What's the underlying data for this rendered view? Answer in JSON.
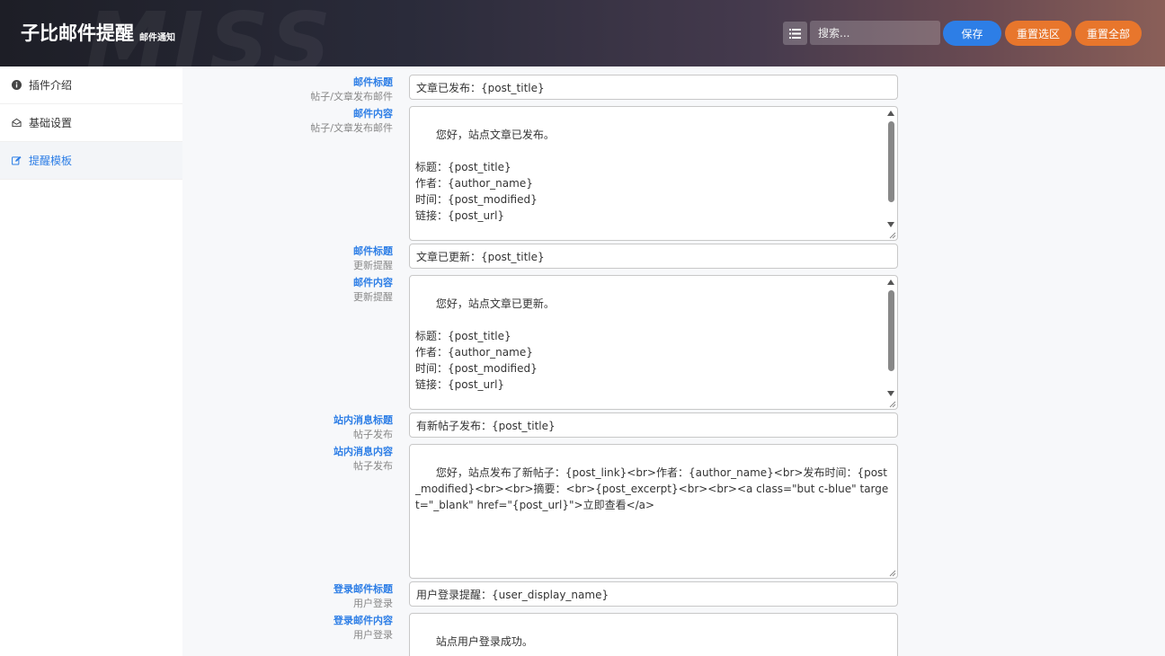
{
  "header": {
    "title": "子比邮件提醒",
    "subtitle": "邮件通知",
    "watermark": "MISS",
    "search_placeholder": "搜索...",
    "save_label": "保存",
    "reset_section_label": "重置选区",
    "reset_all_label": "重置全部"
  },
  "sidebar": {
    "items": [
      {
        "label": "插件介绍",
        "icon": "info-circle-icon"
      },
      {
        "label": "基础设置",
        "icon": "envelope-open-icon"
      },
      {
        "label": "提醒模板",
        "icon": "edit-icon",
        "active": true
      }
    ]
  },
  "fields": {
    "f1": {
      "label": "邮件标题",
      "desc": "帖子/文章发布邮件",
      "value": "文章已发布：{post_title}"
    },
    "f2": {
      "label": "邮件内容",
      "desc": "帖子/文章发布邮件",
      "value": "您好，站点文章已发布。\n\n标题：{post_title}\n作者：{author_name}\n时间：{post_modified}\n链接：{post_url}\n\n摘要："
    },
    "f3": {
      "label": "邮件标题",
      "desc": "更新提醒",
      "value": "文章已更新：{post_title}"
    },
    "f4": {
      "label": "邮件内容",
      "desc": "更新提醒",
      "value": "您好，站点文章已更新。\n\n标题：{post_title}\n作者：{author_name}\n时间：{post_modified}\n链接：{post_url}\n\n摘要："
    },
    "f5": {
      "label": "站内消息标题",
      "desc": "帖子发布",
      "value": "有新帖子发布：{post_title}"
    },
    "f6": {
      "label": "站内消息内容",
      "desc": "帖子发布",
      "value": "您好，站点发布了新帖子：{post_link}<br>作者：{author_name}<br>发布时间：{post_modified}<br><br>摘要：<br>{post_excerpt}<br><br><a class=\"but c-blue\" target=\"_blank\" href=\"{post_url}\">立即查看</a>"
    },
    "f7": {
      "label": "登录邮件标题",
      "desc": "用户登录",
      "value": "用户登录提醒：{user_display_name}"
    },
    "f8": {
      "label": "登录邮件内容",
      "desc": "用户登录",
      "value": "站点用户登录成功。\n\n用户：{user_display_name}（{user_login}）"
    }
  }
}
